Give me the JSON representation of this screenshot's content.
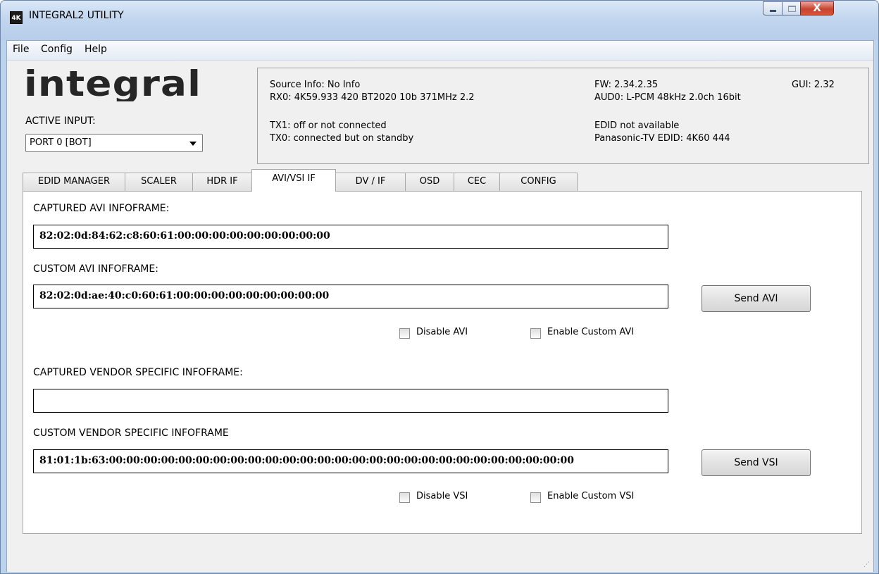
{
  "window": {
    "title": "INTEGRAL2 UTILITY",
    "app_icon": "4K",
    "close_glyph": "X"
  },
  "menu": [
    "File",
    "Config",
    "Help"
  ],
  "logo_text": "integral",
  "active_input": {
    "label": "ACTIVE INPUT:",
    "value": "PORT 0 [BOT]"
  },
  "info": {
    "source": "Source Info: No Info",
    "rx0": "RX0: 4K59.933 420 BT2020 10b 371MHz 2.2",
    "tx1": "TX1: off or not connected",
    "tx0": "TX0: connected but on standby",
    "fw": "FW: 2.34.2.35",
    "gui": "GUI: 2.32",
    "aud0": "AUD0: L-PCM 48kHz 2.0ch 16bit",
    "edid_status": "EDID not available",
    "edid_tv": "Panasonic-TV EDID: 4K60 444"
  },
  "tabs": [
    "EDID MANAGER",
    "SCALER",
    "HDR IF",
    "AVI/VSI IF",
    "DV / IF",
    "OSD",
    "CEC",
    "CONFIG"
  ],
  "active_tab": "AVI/VSI IF",
  "avi": {
    "captured_label": "CAPTURED AVI INFOFRAME:",
    "captured_value": "82:02:0d:84:62:c8:60:61:00:00:00:00:00:00:00:00:00",
    "custom_label": "CUSTOM AVI INFOFRAME:",
    "custom_value": "82:02:0d:ae:40:c0:60:61:00:00:00:00:00:00:00:00:00",
    "send_label": "Send AVI",
    "disable_label": "Disable AVI",
    "enable_custom_label": "Enable Custom AVI"
  },
  "vsi": {
    "captured_label": "CAPTURED VENDOR SPECIFIC INFOFRAME:",
    "captured_value": "",
    "custom_label": "CUSTOM VENDOR SPECIFIC INFOFRAME",
    "custom_value": "81:01:1b:63:00:00:00:00:00:00:00:00:00:00:00:00:00:00:00:00:00:00:00:00:00:00:00:00:00:00:00",
    "send_label": "Send VSI",
    "disable_label": "Disable VSI",
    "enable_custom_label": "Enable Custom VSI"
  },
  "colors": {
    "title_bar": "#c2d6ef",
    "close_button": "#c7452e",
    "panel_bg": "#ffffff",
    "client_bg": "#f0f0f0"
  }
}
